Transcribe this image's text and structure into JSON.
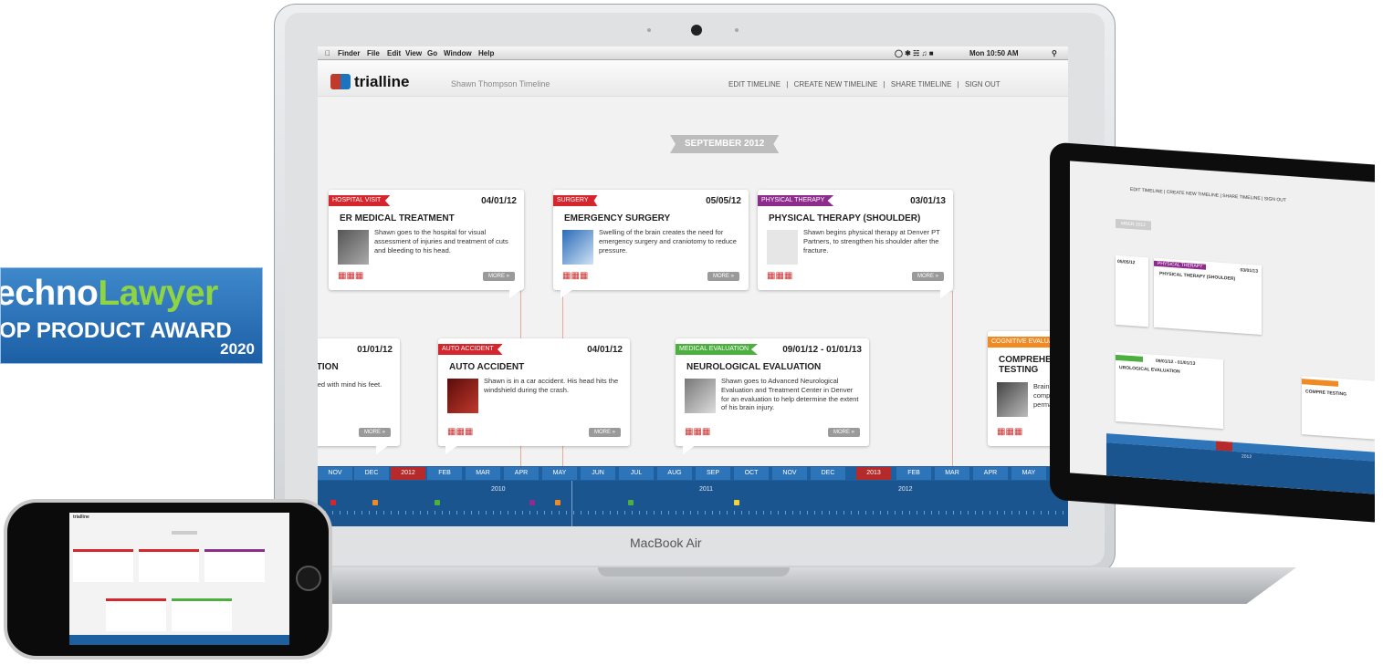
{
  "award": {
    "brand_pre": "echno",
    "brand_post": "Lawyer",
    "line1": "OP PRODUCT AWARD",
    "year": "2020"
  },
  "laptop": {
    "label": "MacBook Air",
    "menubar": {
      "apple": "",
      "items": [
        "Finder",
        "File",
        "Edit",
        "View",
        "Go",
        "Window",
        "Help"
      ],
      "clock": "Mon 10:50 AM"
    },
    "app": {
      "logo": "trialline",
      "subtitle": "Shawn Thompson Timeline",
      "nav": [
        "EDIT TIMELINE",
        "|",
        "CREATE NEW TIMELINE",
        "|",
        "SHARE TIMELINE",
        "|",
        "SIGN OUT"
      ],
      "month_ribbon": "SEPTEMBER 2012",
      "cards": [
        {
          "tag": "HOSPITAL VISIT",
          "date": "04/01/12",
          "title": "ER MEDICAL TREATMENT",
          "desc": "Shawn goes to the hospital for visual assessment of injuries and treatment of cuts and bleeding to his head.",
          "more": "MORE »",
          "color": "#d6262d"
        },
        {
          "tag": "SURGERY",
          "date": "05/05/12",
          "title": "EMERGENCY SURGERY",
          "desc": "Swelling of the brain creates the need for emergency surgery and craniotomy to reduce pressure.",
          "more": "MORE »",
          "color": "#d6262d"
        },
        {
          "tag": "PHYSICAL THERAPY",
          "date": "03/01/13",
          "title": "PHYSICAL THERAPY (SHOULDER)",
          "desc": "Shawn begins physical therapy at Denver PT Partners, to strengthen his shoulder after the fracture.",
          "more": "MORE »",
          "color": "#8e2c8e"
        },
        {
          "tag": "",
          "date": "01/01/12",
          "title": "ITION",
          "desc": "sed with mind his feet.",
          "more": "MORE »",
          "color": "#d6262d"
        },
        {
          "tag": "AUTO ACCIDENT",
          "date": "04/01/12",
          "title": "AUTO ACCIDENT",
          "desc": "Shawn is in a car accident. His head hits the windshield during the crash.",
          "more": "MORE »",
          "color": "#d6262d"
        },
        {
          "tag": "MEDICAL EVALUATION",
          "date": "09/01/12 - 01/01/13",
          "title": "NEUROLOGICAL EVALUATION",
          "desc": "Shawn goes to Advanced Neurological Evaluation and Treatment Center in Denver for an evaluation to help determine the extent of his brain injury.",
          "more": "MORE »",
          "color": "#4caf3f"
        },
        {
          "tag": "COGNITIVE EVALUATI",
          "date": "",
          "title": "COMPREHENS TESTING",
          "desc": "Brain s impro compr to dete perma",
          "more": "",
          "color": "#f08a24"
        }
      ],
      "months": [
        "NOV",
        "DEC",
        "2012",
        "FEB",
        "MAR",
        "APR",
        "MAY",
        "JUN",
        "JUL",
        "AUG",
        "SEP",
        "OCT",
        "NOV",
        "DEC",
        "2013",
        "FEB",
        "MAR",
        "APR",
        "MAY"
      ],
      "years": [
        "2010",
        "2011",
        "2012"
      ]
    }
  },
  "tablet": {
    "nav": "EDIT TIMELINE | CREATE NEW TIMELINE | SHARE TIMELINE | SIGN OUT",
    "ribbon": "MBER 2012",
    "card1_date": "05/05/12",
    "card2_tag": "PHYSICAL THERAPY",
    "card2_date": "03/01/13",
    "card2_title": "PHYSICAL THERAPY (SHOULDER)",
    "card3_date": "09/01/12 - 01/01/13",
    "card3_title": "UROLOGICAL EVALUATION",
    "card4_title": "COMPRE TESTING",
    "year": "2012"
  },
  "phone": {
    "logo": "trialline"
  }
}
